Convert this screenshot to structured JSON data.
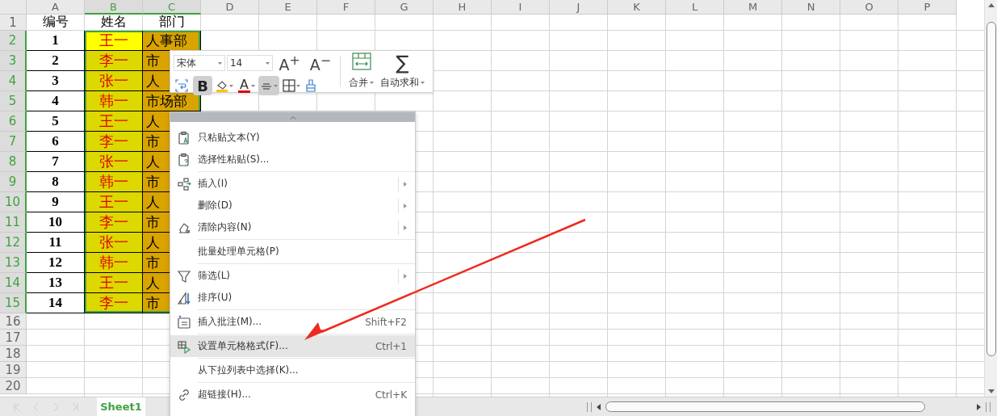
{
  "column_headers": [
    {
      "label": "A",
      "selected": false
    },
    {
      "label": "B",
      "selected": true
    },
    {
      "label": "C",
      "selected": true
    },
    {
      "label": "D",
      "selected": false
    },
    {
      "label": "E",
      "selected": false
    },
    {
      "label": "F",
      "selected": false
    },
    {
      "label": "G",
      "selected": false
    },
    {
      "label": "H",
      "selected": false
    },
    {
      "label": "I",
      "selected": false
    },
    {
      "label": "J",
      "selected": false
    },
    {
      "label": "K",
      "selected": false
    },
    {
      "label": "L",
      "selected": false
    },
    {
      "label": "M",
      "selected": false
    },
    {
      "label": "N",
      "selected": false
    },
    {
      "label": "O",
      "selected": false
    },
    {
      "label": "P",
      "selected": false
    }
  ],
  "rows": [
    {
      "number": "1",
      "selected": false,
      "cells": [
        {
          "text": "编号",
          "active": false
        },
        {
          "text": "姓名",
          "active": false
        },
        {
          "text": "部门",
          "active": false
        }
      ]
    },
    {
      "number": "2",
      "selected": true,
      "cells": [
        {
          "text": "1",
          "active": false
        },
        {
          "text": "王一",
          "active": true
        },
        {
          "text": "人事部",
          "active": false
        }
      ]
    },
    {
      "number": "3",
      "selected": true,
      "cells": [
        {
          "text": "2",
          "active": false
        },
        {
          "text": "李一",
          "active": false
        },
        {
          "text": "市",
          "active": false
        }
      ]
    },
    {
      "number": "4",
      "selected": true,
      "cells": [
        {
          "text": "3",
          "active": false
        },
        {
          "text": "张一",
          "active": false
        },
        {
          "text": "人",
          "active": false
        }
      ]
    },
    {
      "number": "5",
      "selected": true,
      "cells": [
        {
          "text": "4",
          "active": false
        },
        {
          "text": "韩一",
          "active": false
        },
        {
          "text": "市场部",
          "active": false
        }
      ]
    },
    {
      "number": "6",
      "selected": true,
      "cells": [
        {
          "text": "5",
          "active": false
        },
        {
          "text": "王一",
          "active": false
        },
        {
          "text": "人",
          "active": false
        }
      ]
    },
    {
      "number": "7",
      "selected": true,
      "cells": [
        {
          "text": "6",
          "active": false
        },
        {
          "text": "李一",
          "active": false
        },
        {
          "text": "市",
          "active": false
        }
      ]
    },
    {
      "number": "8",
      "selected": true,
      "cells": [
        {
          "text": "7",
          "active": false
        },
        {
          "text": "张一",
          "active": false
        },
        {
          "text": "人",
          "active": false
        }
      ]
    },
    {
      "number": "9",
      "selected": true,
      "cells": [
        {
          "text": "8",
          "active": false
        },
        {
          "text": "韩一",
          "active": false
        },
        {
          "text": "市",
          "active": false
        }
      ]
    },
    {
      "number": "10",
      "selected": true,
      "cells": [
        {
          "text": "9",
          "active": false
        },
        {
          "text": "王一",
          "active": false
        },
        {
          "text": "人",
          "active": false
        }
      ]
    },
    {
      "number": "11",
      "selected": true,
      "cells": [
        {
          "text": "10",
          "active": false
        },
        {
          "text": "李一",
          "active": false
        },
        {
          "text": "市",
          "active": false
        }
      ]
    },
    {
      "number": "12",
      "selected": true,
      "cells": [
        {
          "text": "11",
          "active": false
        },
        {
          "text": "张一",
          "active": false
        },
        {
          "text": "人",
          "active": false
        }
      ]
    },
    {
      "number": "13",
      "selected": true,
      "cells": [
        {
          "text": "12",
          "active": false
        },
        {
          "text": "韩一",
          "active": false
        },
        {
          "text": "市",
          "active": false
        }
      ]
    },
    {
      "number": "14",
      "selected": true,
      "cells": [
        {
          "text": "13",
          "active": false
        },
        {
          "text": "王一",
          "active": false
        },
        {
          "text": "人",
          "active": false
        }
      ]
    },
    {
      "number": "15",
      "selected": true,
      "cells": [
        {
          "text": "14",
          "active": false
        },
        {
          "text": "李一",
          "active": false
        },
        {
          "text": "市",
          "active": false
        }
      ]
    },
    {
      "number": "16",
      "selected": false
    },
    {
      "number": "17",
      "selected": false
    },
    {
      "number": "18",
      "selected": false
    },
    {
      "number": "19",
      "selected": false
    },
    {
      "number": "20",
      "selected": false
    }
  ],
  "mini_toolbar": {
    "font": "宋体",
    "size": "14",
    "grow_font": "A$^{+}$",
    "shrink_font": "A$^{−}$",
    "bold": {
      "label": "B",
      "selected": true
    },
    "font_color": "A",
    "align_selected": true,
    "sum_symbol": "∑",
    "merge_label": "合并",
    "sum_label": "自动求和"
  },
  "context_menu": {
    "items": [
      {
        "kind": "item",
        "label": "只粘贴文本(Y)",
        "submenu": false,
        "highlighted": false
      },
      {
        "kind": "item",
        "label": "选择性粘贴(S)...",
        "submenu": false,
        "highlighted": false
      },
      {
        "kind": "separator"
      },
      {
        "kind": "item",
        "label": "插入(I)",
        "submenu": true,
        "highlighted": false
      },
      {
        "kind": "item",
        "label": "删除(D)",
        "submenu": true,
        "highlighted": false
      },
      {
        "kind": "item",
        "label": "清除内容(N)",
        "submenu": true,
        "highlighted": false
      },
      {
        "kind": "separator"
      },
      {
        "kind": "item",
        "label": "批量处理单元格(P)",
        "submenu": false,
        "highlighted": false
      },
      {
        "kind": "separator"
      },
      {
        "kind": "item",
        "label": "筛选(L)",
        "submenu": true,
        "highlighted": false
      },
      {
        "kind": "item",
        "label": "排序(U)",
        "submenu": false,
        "highlighted": false
      },
      {
        "kind": "separator"
      },
      {
        "kind": "item",
        "label": "插入批注(M)...",
        "shortcut": "Shift+F2",
        "submenu": false,
        "highlighted": false
      },
      {
        "kind": "separator"
      },
      {
        "kind": "item",
        "label": "设置单元格格式(F)...",
        "shortcut": "Ctrl+1",
        "submenu": false,
        "highlighted": true
      },
      {
        "kind": "separator"
      },
      {
        "kind": "item",
        "label": "从下拉列表中选择(K)...",
        "submenu": false,
        "highlighted": false
      },
      {
        "kind": "separator"
      },
      {
        "kind": "item",
        "label": "超链接(H)...",
        "shortcut": "Ctrl+K",
        "submenu": false,
        "highlighted": false
      }
    ]
  },
  "sheet_tabs": [
    {
      "label": "Sheet1",
      "selected": true
    }
  ]
}
